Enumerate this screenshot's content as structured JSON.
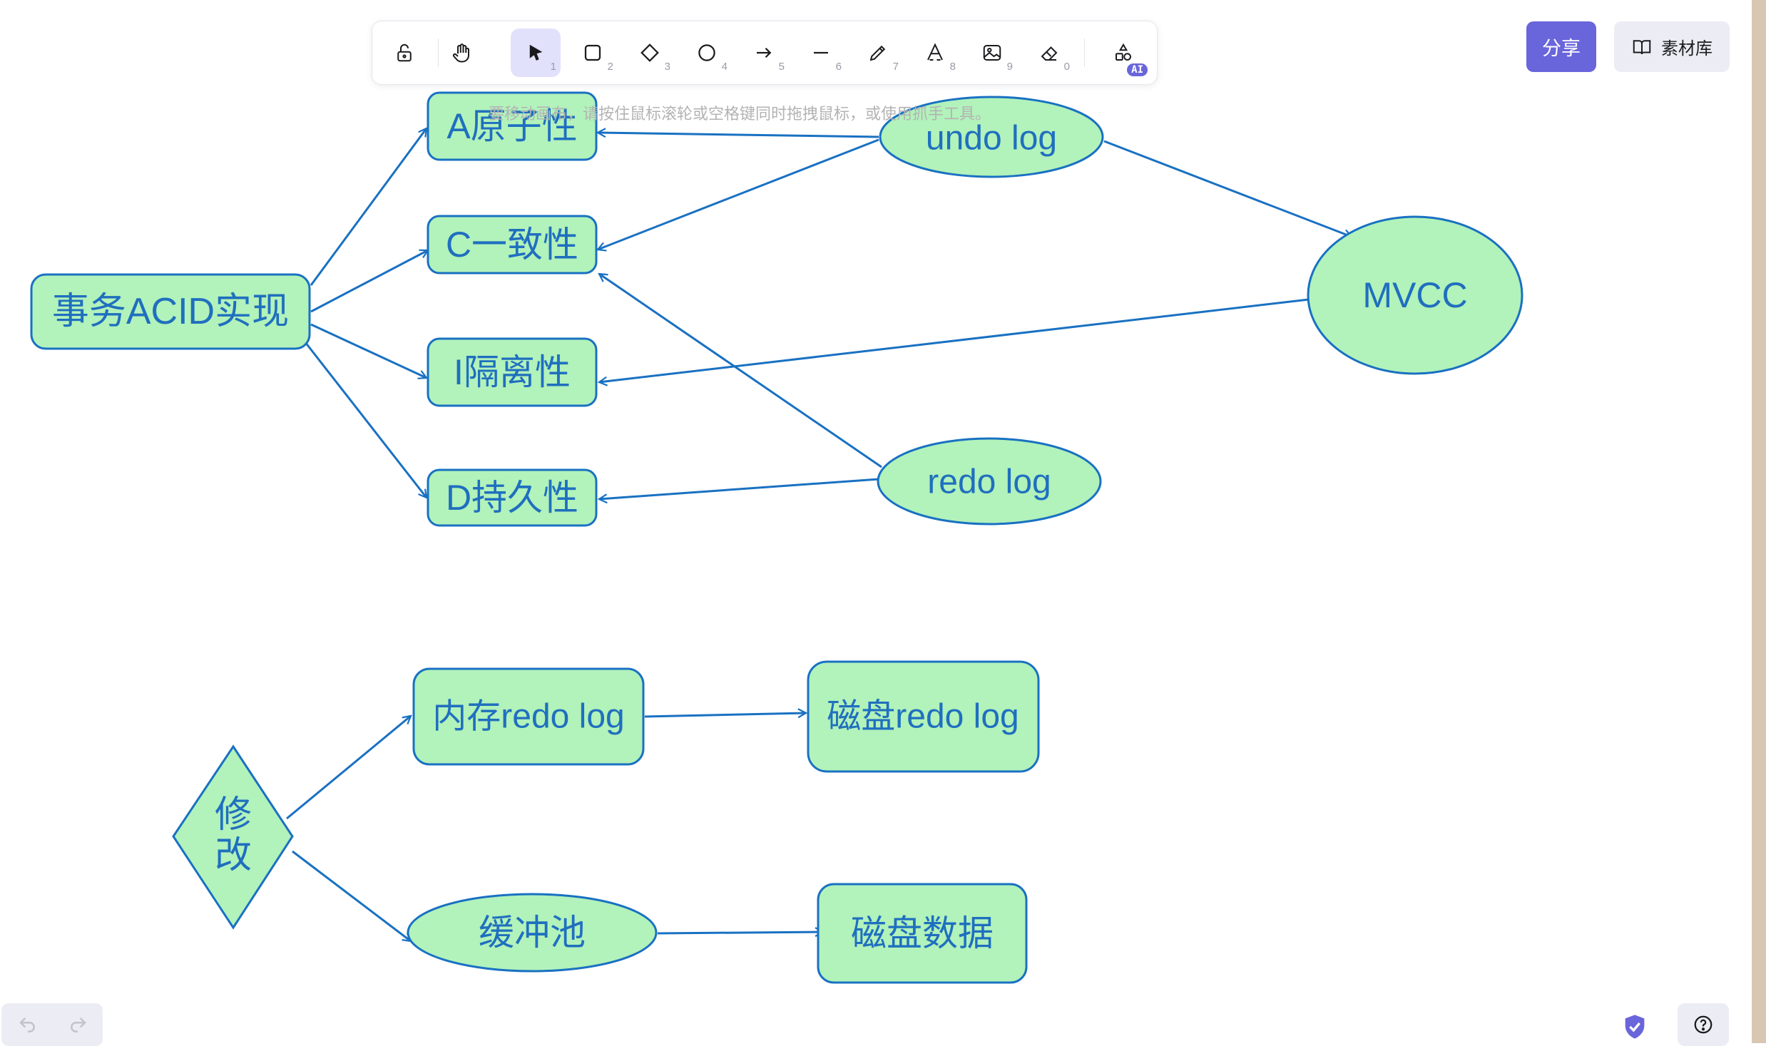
{
  "toolbar": {
    "tools": [
      {
        "name": "lock-tool",
        "key": ""
      },
      {
        "name": "hand-tool",
        "key": ""
      },
      {
        "name": "selection-tool",
        "key": "1"
      },
      {
        "name": "rectangle-tool",
        "key": "2"
      },
      {
        "name": "diamond-tool",
        "key": "3"
      },
      {
        "name": "ellipse-tool",
        "key": "4"
      },
      {
        "name": "arrow-tool",
        "key": "5"
      },
      {
        "name": "line-tool",
        "key": "6"
      },
      {
        "name": "draw-tool",
        "key": "7"
      },
      {
        "name": "text-tool",
        "key": "8"
      },
      {
        "name": "image-tool",
        "key": "9"
      },
      {
        "name": "eraser-tool",
        "key": "0"
      },
      {
        "name": "more-shapes-tool",
        "key": ""
      }
    ],
    "ai_badge": "AI"
  },
  "hint": "要移动画布，请按住鼠标滚轮或空格键同时拖拽鼠标，或使用抓手工具。",
  "share_label": "分享",
  "library_label": "素材库",
  "colors": {
    "accent": "#6965db",
    "node_fill": "#b2f2bb",
    "stroke": "#1971c2",
    "text": "#1f6fbf"
  },
  "diagram": {
    "nodes": {
      "acid": "事务ACID实现",
      "atomicity": "A原子性",
      "consistency": "C一致性",
      "isolation": "I隔离性",
      "durability": "D持久性",
      "undo_log": "undo log",
      "redo_log": "redo log",
      "mvcc": "MVCC",
      "modify": [
        "修",
        "改"
      ],
      "mem_redo": "内存redo log",
      "disk_redo": "磁盘redo log",
      "buffer_pool": "缓冲池",
      "disk_data": "磁盘数据"
    }
  }
}
